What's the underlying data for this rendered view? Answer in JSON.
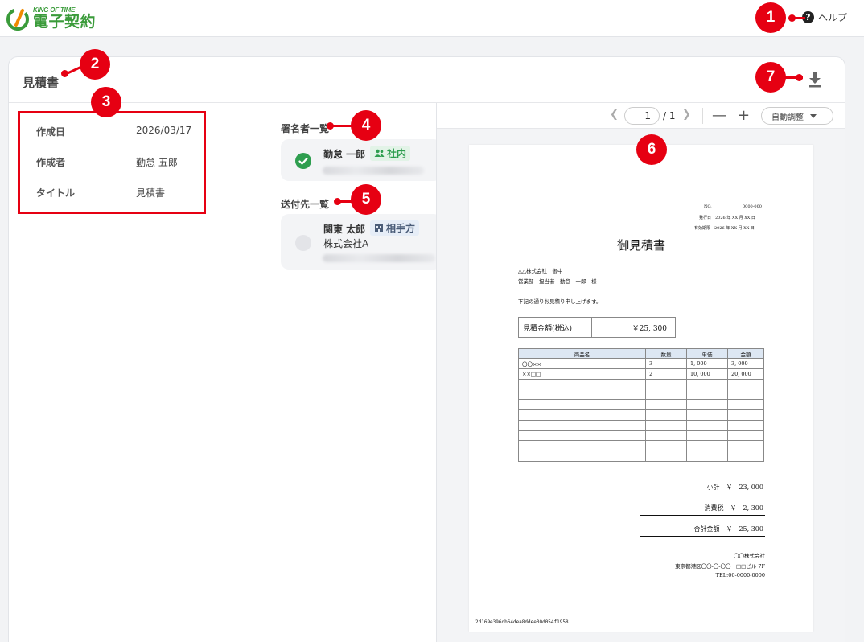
{
  "header": {
    "logo_small": "KING OF TIME",
    "logo_big": "電子契約",
    "help_label": "ヘルプ"
  },
  "document": {
    "title": "見積書"
  },
  "info": [
    {
      "key": "作成日",
      "value": "2026/03/17"
    },
    {
      "key": "作成者",
      "value": "勤怠 五郎"
    },
    {
      "key": "タイトル",
      "value": "見積書"
    }
  ],
  "signers": {
    "label": "署名者一覧",
    "items": [
      {
        "name": "勤怠 一郎",
        "tag": "社内",
        "status": "signed"
      }
    ]
  },
  "recipients": {
    "label": "送付先一覧",
    "items": [
      {
        "name": "関東 太郎",
        "tag": "相手方",
        "company": "株式会社A",
        "status": "pending"
      }
    ]
  },
  "viewer": {
    "page_current": "1",
    "page_total": "/ 1",
    "zoom_label": "自動調整"
  },
  "paper": {
    "meta_no_label": "NO.",
    "meta_no_value": "0000-000",
    "meta_issue": "発行日　2026 年 XX 月 XX 日",
    "meta_expiry": "有効期限　2026 年 XX 月 XX 日",
    "title": "御見積書",
    "to_company": "△△株式会社　御中",
    "to_person": "営業部　担当者　勤怠　一郎　様",
    "intro": "下記の通りお見積り申し上げます。",
    "amount_label": "見積金額(税込)",
    "amount_value": "￥25, 300",
    "table_headers": [
      "商品名",
      "数量",
      "単価",
      "金額"
    ],
    "rows": [
      [
        "〇〇××",
        "3",
        "1, 000",
        "3, 000"
      ],
      [
        "××□□",
        "2",
        "10, 000",
        "20, 000"
      ],
      [
        "",
        "",
        "",
        ""
      ],
      [
        "",
        "",
        "",
        ""
      ],
      [
        "",
        "",
        "",
        ""
      ],
      [
        "",
        "",
        "",
        ""
      ],
      [
        "",
        "",
        "",
        ""
      ],
      [
        "",
        "",
        "",
        ""
      ],
      [
        "",
        "",
        "",
        ""
      ],
      [
        "",
        "",
        "",
        ""
      ]
    ],
    "subtotal": "小計　￥　23, 000",
    "tax": "消費税　￥　2, 300",
    "total": "合計金額　￥　25, 300",
    "issuer_company": "〇〇株式会社",
    "issuer_address": "東京都港区〇〇-〇-〇〇　□□ビル 7F",
    "issuer_tel": "TEL:00-0000-0000",
    "hash": "2d169e396db64dea8ddee00d054f1958"
  },
  "markers": [
    "1",
    "2",
    "3",
    "4",
    "5",
    "6",
    "7"
  ],
  "colors": {
    "brand_green": "#3a9b3a",
    "marker_red": "#e60012",
    "signed_green": "#2e9e4f"
  }
}
